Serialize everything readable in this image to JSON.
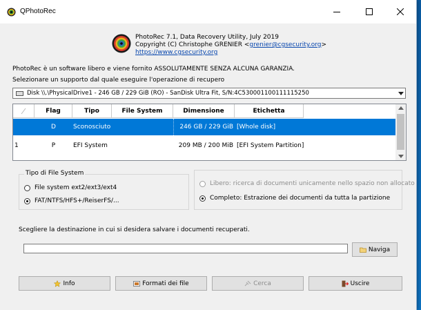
{
  "window": {
    "title": "QPhotoRec"
  },
  "header": {
    "line1": "PhotoRec 7.1, Data Recovery Utility, July 2019",
    "copyright_prefix": "Copyright (C) Christophe GRENIER <",
    "email": "grenier@cgsecurity.org",
    "copyright_suffix": ">",
    "website": "https://www.cgsecurity.org"
  },
  "disclaimer": "PhotoRec è un software libero e viene fornito ASSOLUTAMENTE SENZA ALCUNA GARANZIA.",
  "select_prompt": "Selezionare un supporto dal quale eseguire l'operazione di recupero",
  "disk_combo": {
    "value": "Disk \\\\.\\PhysicalDrive1 - 246 GB / 229 GiB (RO) - SanDisk Ultra Fit, S/N:4C530001100111115250"
  },
  "partition_table": {
    "columns": [
      "",
      "Flag",
      "Tipo",
      "File System",
      "Dimensione",
      "Etichetta"
    ],
    "rows": [
      {
        "num": "",
        "flag": "D",
        "type": "Sconosciuto",
        "fs": "",
        "size": "246 GB / 229 GiB",
        "label": "[Whole disk]",
        "selected": true
      },
      {
        "num": "1",
        "flag": "P",
        "type": "EFI System",
        "fs": "",
        "size": "209 MB / 200 MiB",
        "label": "[EFI System Partition]",
        "selected": false
      }
    ]
  },
  "fs_group": {
    "title": "Tipo di File System",
    "option_ext": "File system ext2/ext3/ext4",
    "option_fat": "FAT/NTFS/HFS+/ReiserFS/...",
    "selected": "fat"
  },
  "scope_group": {
    "option_free": "Libero: ricerca di documenti unicamente nello spazio non allocato",
    "option_whole": "Completo: Estrazione dei documenti da tutta la partizione",
    "selected": "whole"
  },
  "destination": {
    "prompt": "Scegliere la destinazione in cui si desidera salvare i documenti recuperati.",
    "path_value": "",
    "browse_label": "Naviga"
  },
  "buttons": {
    "info": "Info",
    "formats": "Formati dei file",
    "search": "Cerca",
    "quit": "Uscire"
  },
  "colors": {
    "selection": "#0078d7",
    "link": "#0645ad"
  }
}
